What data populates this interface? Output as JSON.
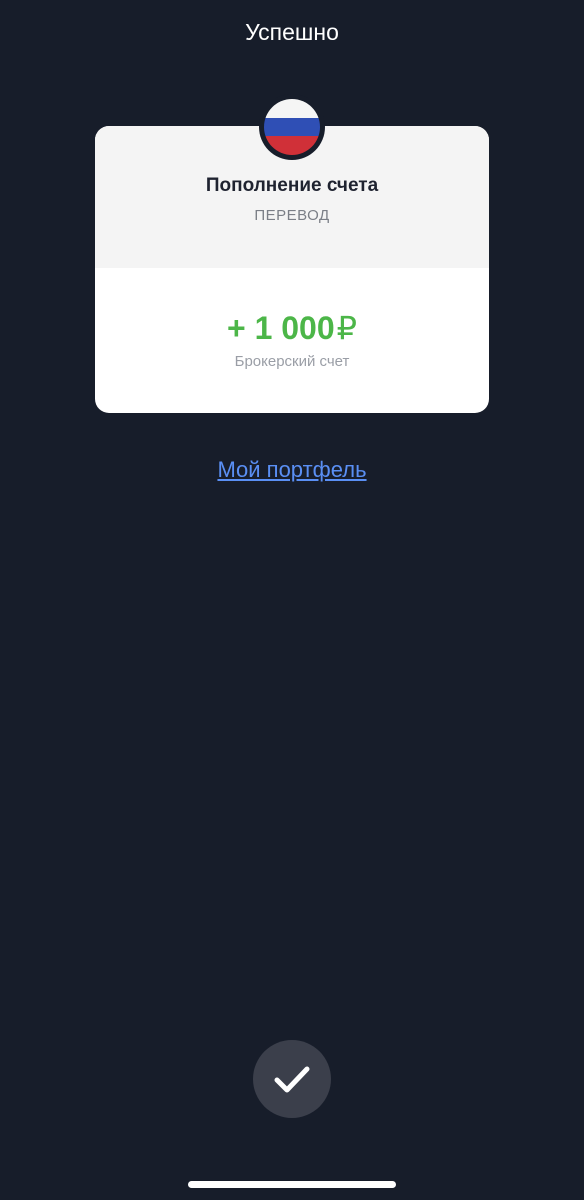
{
  "header": {
    "title": "Успешно"
  },
  "card": {
    "icon": "russia-flag-icon",
    "flag_colors": [
      "#f5f5f5",
      "#2f4fb5",
      "#d03038"
    ],
    "title": "Пополнение счета",
    "subtitle": "ПЕРЕВОД",
    "amount": "+ 1 000",
    "currency": "₽",
    "amount_color": "#4cb648",
    "account": "Брокерский счет"
  },
  "actions": {
    "portfolio_link": "Мой портфель",
    "link_color": "#5a8ff4",
    "done_icon": "checkmark-icon"
  },
  "colors": {
    "background": "#171d2a"
  }
}
